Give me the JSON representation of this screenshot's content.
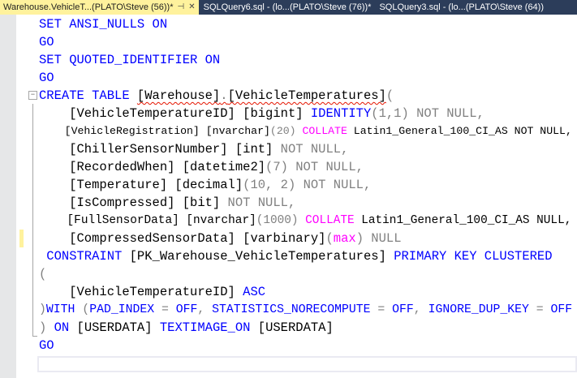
{
  "tabs": [
    {
      "label": "Warehouse.VehicleT...(PLATO\\Steve (56))*",
      "active": true,
      "pin": "⊣",
      "close": "✕"
    },
    {
      "label": "SQLQuery6.sql - (lo...(PLATO\\Steve (76))*"
    },
    {
      "label": "SQLQuery3.sql - (lo...(PLATO\\Steve (64))"
    }
  ],
  "colors": {
    "keyword": "#0000ff",
    "operator": "#808080",
    "function": "#ff00ff"
  },
  "code_lines": [
    [
      [
        "kw",
        "SET ANSI_NULLS ON"
      ]
    ],
    [
      [
        "kw",
        "GO"
      ]
    ],
    [
      [
        "kw",
        "SET QUOTED_IDENTIFIER ON"
      ]
    ],
    [
      [
        "kw",
        "GO"
      ]
    ],
    [
      [
        "kw",
        "CREATE TABLE "
      ],
      [
        "squig",
        "[Warehouse]"
      ],
      [
        "gray squig",
        "."
      ],
      [
        "squig",
        "[VehicleTemperatures]"
      ],
      [
        "gray",
        "("
      ]
    ],
    [
      [
        "",
        "    [VehicleTemperatureID] [bigint] "
      ],
      [
        "kw",
        "IDENTITY"
      ],
      [
        "gray",
        "(1,1) NOT NULL,"
      ]
    ],
    [
      [
        "",
        "    [VehicleRegistration] [nvarchar]"
      ],
      [
        "gray",
        "(20) "
      ],
      [
        "pink",
        "COLLATE"
      ],
      [
        "",
        " Latin1_General_100_CI_AS NOT NULL,"
      ]
    ],
    [
      [
        "",
        "    [ChillerSensorNumber] [int] "
      ],
      [
        "gray",
        "NOT NULL,"
      ]
    ],
    [
      [
        "",
        "    [RecordedWhen] [datetime2]"
      ],
      [
        "gray",
        "(7) NOT NULL,"
      ]
    ],
    [
      [
        "",
        "    [Temperature] [decimal]"
      ],
      [
        "gray",
        "(10, 2) NOT NULL,"
      ]
    ],
    [
      [
        "",
        "    [IsCompressed] [bit] "
      ],
      [
        "gray",
        "NOT NULL,"
      ]
    ],
    [
      [
        "",
        "    [FullSensorData] [nvarchar]"
      ],
      [
        "gray",
        "(1000) "
      ],
      [
        "pink",
        "COLLATE"
      ],
      [
        "",
        " Latin1_General_100_CI_AS NULL,"
      ]
    ],
    [
      [
        "",
        "    [CompressedSensorData] [varbinary]"
      ],
      [
        "gray",
        "("
      ],
      [
        "pink",
        "max"
      ],
      [
        "gray",
        ") NULL"
      ]
    ],
    [
      [
        "kw",
        " CONSTRAINT "
      ],
      [
        "",
        "[PK_Warehouse_VehicleTemperatures] "
      ],
      [
        "kw",
        "PRIMARY KEY CLUSTERED"
      ]
    ],
    [
      [
        "gray",
        "("
      ]
    ],
    [
      [
        "",
        "    [VehicleTemperatureID] "
      ],
      [
        "kw",
        "ASC"
      ]
    ],
    [
      [
        "gray",
        ")"
      ],
      [
        "kw",
        "WITH "
      ],
      [
        "gray",
        "("
      ],
      [
        "kw",
        "PAD_INDEX "
      ],
      [
        "gray",
        "= "
      ],
      [
        "kw",
        "OFF"
      ],
      [
        "gray",
        ", "
      ],
      [
        "kw",
        "STATISTICS_NORECOMPUTE "
      ],
      [
        "gray",
        "= "
      ],
      [
        "kw",
        "OFF"
      ],
      [
        "gray",
        ", "
      ],
      [
        "kw",
        "IGNORE_DUP_KEY "
      ],
      [
        "gray",
        "= "
      ],
      [
        "kw",
        "OFF"
      ]
    ],
    [
      [
        "gray",
        ") "
      ],
      [
        "kw",
        "ON "
      ],
      [
        "",
        "[USERDATA] "
      ],
      [
        "kw",
        "TEXTIMAGE_ON "
      ],
      [
        "",
        "[USERDATA]"
      ]
    ],
    [
      [
        "kw",
        "GO"
      ]
    ]
  ]
}
